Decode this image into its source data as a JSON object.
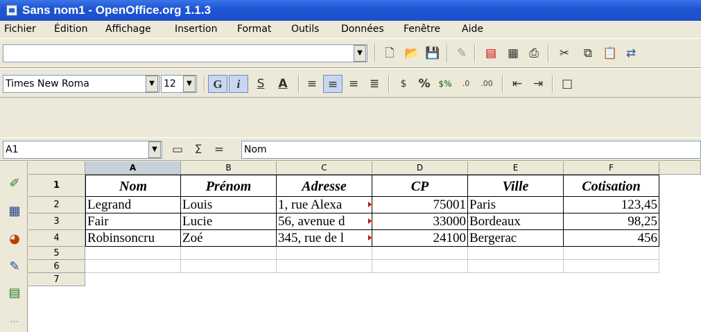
{
  "window": {
    "title": "Sans nom1 - OpenOffice.org 1.1.3"
  },
  "menu": [
    "Fichier",
    "Édition",
    "Affichage",
    "Insertion",
    "Format",
    "Outils",
    "Données",
    "Fenêtre",
    "Aide"
  ],
  "toolbar": {
    "url_value": ""
  },
  "format_bar": {
    "font_name": "Times New Roma",
    "font_size": "12"
  },
  "formula_bar": {
    "cell_ref": "A1",
    "sigma": "Σ",
    "equals": "=",
    "content": "Nom"
  },
  "sheet": {
    "columns": [
      "A",
      "B",
      "C",
      "D",
      "E",
      "F"
    ],
    "rows": [
      "1",
      "2",
      "3",
      "4",
      "5",
      "6",
      "7"
    ],
    "header_row": [
      "Nom",
      "Prénom",
      "Adresse",
      "CP",
      "Ville",
      "Cotisation"
    ],
    "data": [
      [
        "Legrand",
        "Louis",
        "1, rue Alexa",
        "75001",
        "Paris",
        "123,45"
      ],
      [
        "Fair",
        "Lucie",
        "56, avenue d",
        "33000",
        "Bordeaux",
        "98,25"
      ],
      [
        "Robinsoncru",
        "Zoé",
        "345, rue de l",
        "24100",
        "Bergerac",
        "456"
      ]
    ]
  },
  "icons": {
    "toolbar": [
      "new-document-icon",
      "open-folder-icon",
      "save-icon",
      "edit-file-icon",
      "export-pdf-icon",
      "print-preview-icon",
      "print-icon",
      "cut-icon",
      "copy-icon",
      "paste-icon",
      "arrow-icon"
    ],
    "format": [
      "bold-icon",
      "italic-icon",
      "underline-icon",
      "font-color-icon",
      "align-left-icon",
      "align-center-icon",
      "align-right-icon",
      "justify-icon",
      "currency-icon",
      "percent-icon",
      "standard-format-icon",
      "add-decimal-icon",
      "delete-decimal-icon",
      "decrease-indent-icon",
      "increase-indent-icon",
      "borders-icon"
    ],
    "side": [
      "navigator-icon",
      "data-pilot-icon",
      "chart-icon",
      "draw-icon",
      "gallery-icon",
      "more-icon"
    ]
  }
}
